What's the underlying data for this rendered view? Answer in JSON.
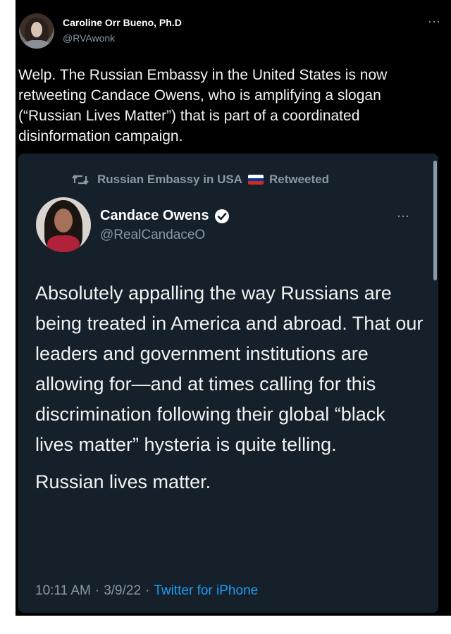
{
  "outer_tweet": {
    "author_name": "Caroline Orr Bueno, Ph.D",
    "author_handle": "@RVAwonk",
    "more_icon": "more-horizontal-icon",
    "text": "Welp. The Russian Embassy in the United States is now retweeting Candace Owens, who is amplifying a slogan (“Russian Lives Matter”) that is part of a coordinated disinformation campaign."
  },
  "embedded_tweet": {
    "retweet_by": "Russian Embassy in USA",
    "retweet_suffix": "Retweeted",
    "retweet_icon": "retweet-icon",
    "flag_icon": "russian-flag-icon",
    "flag_colors": [
      "#ffffff",
      "#0039a6",
      "#d52b1e"
    ],
    "author_name": "Candace Owens",
    "verified_icon": "verified-badge-icon",
    "verified_color": "#1d9bf0",
    "author_handle": "@RealCandaceO",
    "paragraph_1": "Absolutely appalling the way Russians are being treated in America and abroad. That our leaders and government institutions are allowing for—and at times calling for this discrimination following their global “black lives matter” hysteria is quite telling.",
    "paragraph_2": "Russian lives matter.",
    "time": "10:11 AM",
    "date": "3/9/22",
    "separator": "·",
    "source": "Twitter for iPhone"
  },
  "colors": {
    "outer_background": "#000000",
    "card_background": "#15202b",
    "secondary_text": "#8b98a5",
    "link": "#1d9bf0"
  }
}
